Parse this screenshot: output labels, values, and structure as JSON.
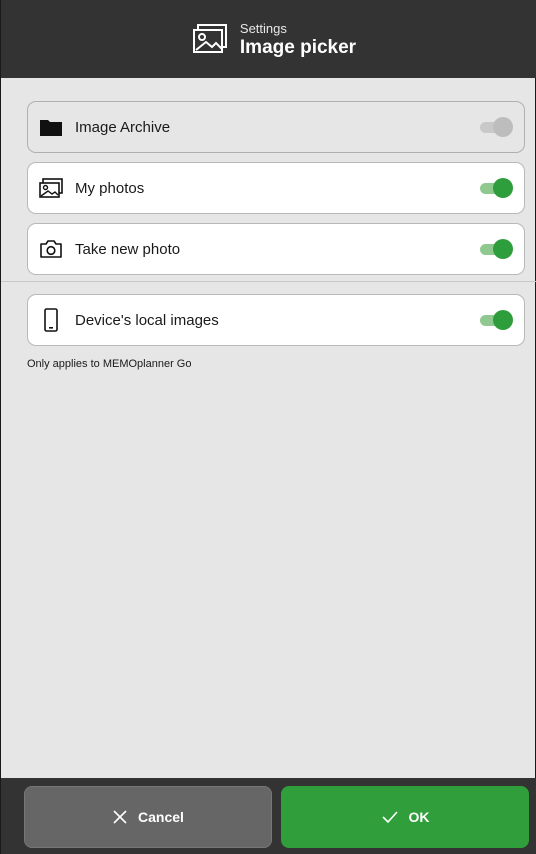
{
  "header": {
    "subtitle": "Settings",
    "title": "Image picker",
    "icon": "image-icon"
  },
  "options": [
    {
      "label": "Image Archive",
      "icon": "folder-icon",
      "enabled": false
    },
    {
      "label": "My photos",
      "icon": "photos-icon",
      "enabled": true
    },
    {
      "label": "Take new photo",
      "icon": "camera-icon",
      "enabled": true
    },
    {
      "label": "Device's local images",
      "icon": "phone-icon",
      "enabled": true
    }
  ],
  "note": "Only applies to MEMOplanner Go",
  "footer": {
    "cancel_label": "Cancel",
    "ok_label": "OK"
  },
  "colors": {
    "header_bg": "#333333",
    "accent_green": "#2f9e3b",
    "cancel_bg": "#666666"
  }
}
